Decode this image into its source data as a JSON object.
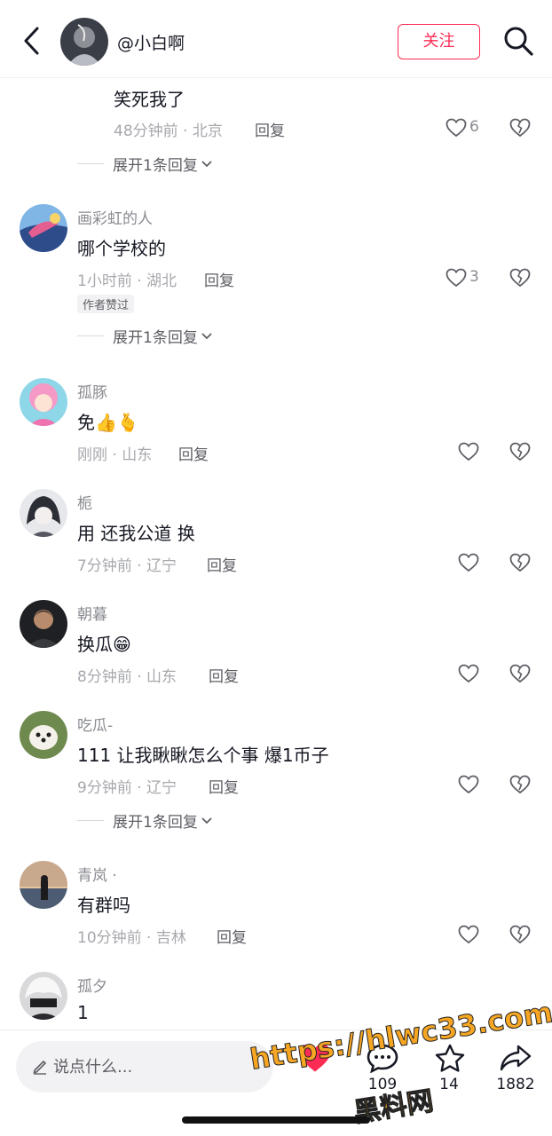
{
  "header": {
    "username": "@小白啊",
    "follow_label": "关注"
  },
  "comments": [
    {
      "text": "笑死我了",
      "time_loc": "48分钟前 · 北京",
      "reply": "回复",
      "likes": "6",
      "expand": "展开1条回复"
    },
    {
      "name": "画彩虹的人",
      "text": "哪个学校的",
      "time_loc": "1小时前 · 湖北",
      "reply": "回复",
      "likes": "3",
      "badge": "作者赞过",
      "expand": "展开1条回复"
    },
    {
      "name": "孤豚",
      "text": "免👍🫰",
      "time_loc": "刚刚 · 山东",
      "reply": "回复"
    },
    {
      "name": "栀",
      "text": "用 还我公道 换",
      "time_loc": "7分钟前 · 辽宁",
      "reply": "回复"
    },
    {
      "name": "朝暮",
      "text": "换瓜😁",
      "time_loc": "8分钟前 · 山东",
      "reply": "回复"
    },
    {
      "name": "吃瓜-",
      "text": "111 让我瞅瞅怎么个事 爆1币子",
      "time_loc": "9分钟前 · 辽宁",
      "reply": "回复",
      "expand": "展开1条回复"
    },
    {
      "name": "青岚 ·",
      "text": "有群吗",
      "time_loc": "10分钟前 · 吉林",
      "reply": "回复"
    },
    {
      "name": "孤夕",
      "text": "1"
    }
  ],
  "bottom_bar": {
    "input_placeholder": "说点什么...",
    "comment_count": "109",
    "favorite_count": "14",
    "share_count": "1882"
  },
  "watermark": {
    "url": "https://hlwc33.com",
    "label": "黑料网"
  },
  "colors": {
    "accent": "#fe2c55",
    "text_primary": "#161823",
    "text_secondary": "#8a8b91"
  }
}
